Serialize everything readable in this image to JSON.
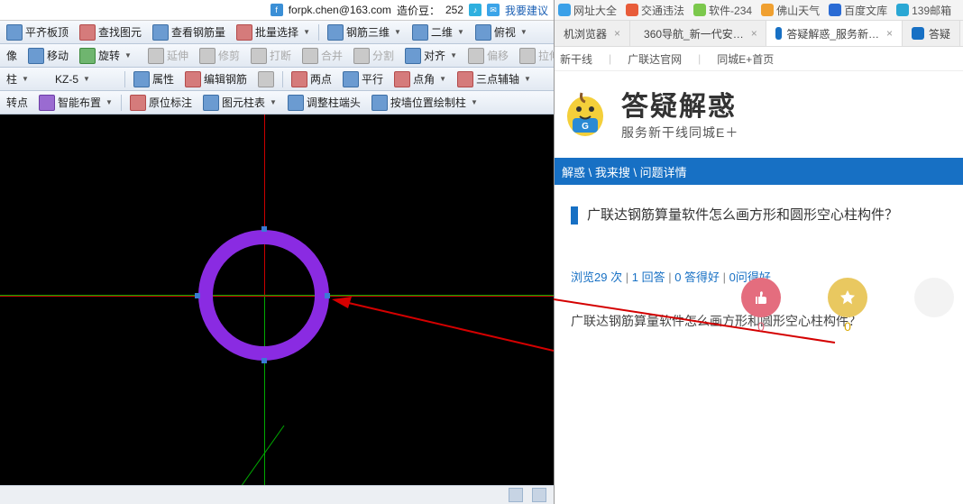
{
  "info": {
    "email": "forpk.chen@163.com",
    "bean_label": "造价豆：",
    "bean_value": "252",
    "suggest": "我要建议"
  },
  "tb1": {
    "b0": "平齐板顶",
    "b1": "查找图元",
    "b2": "查看钢筋量",
    "b3": "批量选择",
    "b4": "钢筋三维",
    "b5": "二维",
    "b6": "俯视"
  },
  "tb2": {
    "b0": "像",
    "b1": "移动",
    "b2": "旋转",
    "b3": "延伸",
    "b4": "修剪",
    "b5": "打断",
    "b6": "合并",
    "b7": "分割",
    "b8": "对齐",
    "b9": "偏移",
    "b10": "拉伸"
  },
  "tb3": {
    "sel1": "柱",
    "sel2": "KZ-5",
    "b0": "属性",
    "b1": "编辑钢筋",
    "b2": "两点",
    "b3": "平行",
    "b4": "点角",
    "b5": "三点辅轴"
  },
  "tb4": {
    "b0": "转点",
    "b1": "智能布置",
    "b2": "原位标注",
    "b3": "图元柱表",
    "b4": "调整柱端头",
    "b5": "按墙位置绘制柱"
  },
  "bookmarks": {
    "b0": "网址大全",
    "b1": "交通违法",
    "b2": "软件-234",
    "b3": "佛山天气",
    "b4": "百度文库",
    "b5": "139邮箱"
  },
  "tabs": {
    "t0": "机浏览器",
    "t1": "360导航_新一代安…",
    "t2": "答疑解惑_服务新…",
    "t3": "答疑"
  },
  "nav": {
    "n0": "新干线",
    "n1": "广联达官网",
    "n2": "同城E+首页"
  },
  "brand": {
    "title": "答疑解惑",
    "sub": "服务新干线同城E＋"
  },
  "crumb": "解惑 \\ 我来搜 \\ 问题详情",
  "question": {
    "title": "广联达钢筋算量软件怎么画方形和圆形空心柱构件？",
    "meta_views_prefix": "浏览",
    "meta_views_value": "29",
    "meta_views_suffix": " 次",
    "meta_ans": "1 回答",
    "meta_good": "0 答得好",
    "meta_ask": "0问得好",
    "body": "广联达钢筋算量软件怎么画方形和圆形空心柱构件？"
  },
  "votes": {
    "up": "0",
    "fav": "0"
  }
}
